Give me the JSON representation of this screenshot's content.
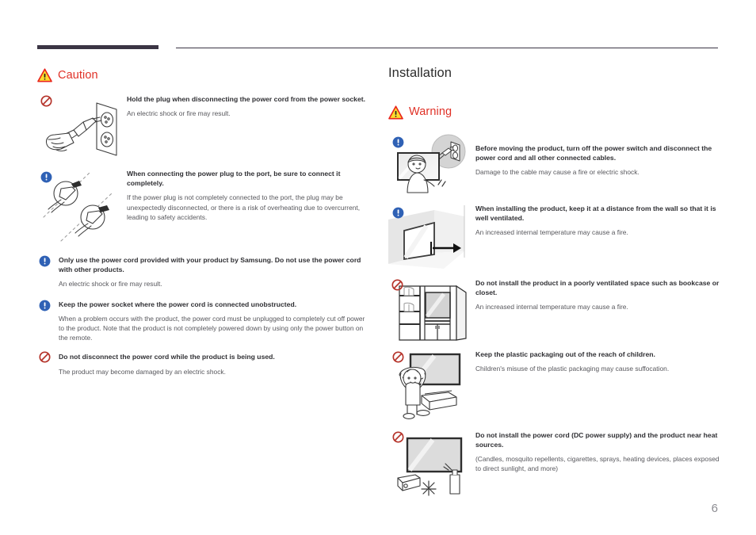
{
  "page": {
    "number": "6",
    "rule_color": "#3b3544",
    "caution_color": "#e03127",
    "heading_color": "#2f2f33",
    "body_color": "#57575c",
    "prohibit_color": "#b5332a",
    "info_color": "#2f61b5"
  },
  "left_column": {
    "banner": {
      "icon": "warning-triangle-icon",
      "label": "Caution"
    },
    "items": [
      {
        "badge": "prohibition-icon",
        "illustration": "hand-pulling-plug-from-socket-illustration",
        "heading": "Hold the plug when disconnecting the power cord from the power socket.",
        "body": "An electric shock or fire may result."
      },
      {
        "badge": "info-icon",
        "illustration": "plug-not-fully-inserted-illustration",
        "heading": "When connecting the power plug to the port, be sure to connect it completely.",
        "body": "If the power plug is not completely connected to the port, the plug may be unexpectedly disconnected, or there is a risk of overheating due to overcurrent, leading to safety accidents."
      },
      {
        "badge": "info-icon",
        "illustration": null,
        "heading": "Only use the power cord provided with your product by Samsung. Do not use the power cord with other products.",
        "body": "An electric shock or fire may result."
      },
      {
        "badge": "info-icon",
        "illustration": null,
        "heading": "Keep the power socket where the power cord is connected unobstructed.",
        "body": "When a problem occurs with the product, the power cord must be unplugged to completely cut off power to the product. Note that the product is not completely powered down by using only the power button on the remote."
      },
      {
        "badge": "prohibition-icon",
        "illustration": null,
        "heading": "Do not disconnect the power cord while the product is being used.",
        "body": "The product may become damaged by an electric shock."
      }
    ]
  },
  "right_column": {
    "title": "Installation",
    "banner": {
      "icon": "warning-triangle-icon",
      "label": "Warning"
    },
    "items": [
      {
        "badge": "info-icon",
        "illustration": "person-moving-display-illustration",
        "heading": "Before moving the product, turn off the power switch and disconnect the power cord and all other connected cables.",
        "body": "Damage to the cable may cause a fire or electric shock."
      },
      {
        "badge": "info-icon",
        "illustration": "display-distance-from-wall-illustration",
        "heading": "When installing the product, keep it at a distance from the wall so that it is well ventilated.",
        "body": "An increased internal temperature may cause a fire."
      },
      {
        "badge": "prohibition-icon",
        "illustration": "display-in-bookcase-illustration",
        "heading": "Do not install the product in a poorly ventilated space such as bookcase or closet.",
        "body": "An increased internal temperature may cause a fire."
      },
      {
        "badge": "prohibition-icon",
        "illustration": "child-with-plastic-packaging-illustration",
        "heading": "Keep the plastic packaging out of the reach of children.",
        "body": "Children's misuse of the plastic packaging may cause suffocation."
      },
      {
        "badge": "prohibition-icon",
        "illustration": "display-near-heat-sources-illustration",
        "heading": "Do not install the power cord (DC power supply) and the product near heat sources.",
        "body": "(Candles, mosquito repellents, cigarettes, sprays, heating devices, places exposed to direct sunlight, and more)"
      }
    ]
  }
}
